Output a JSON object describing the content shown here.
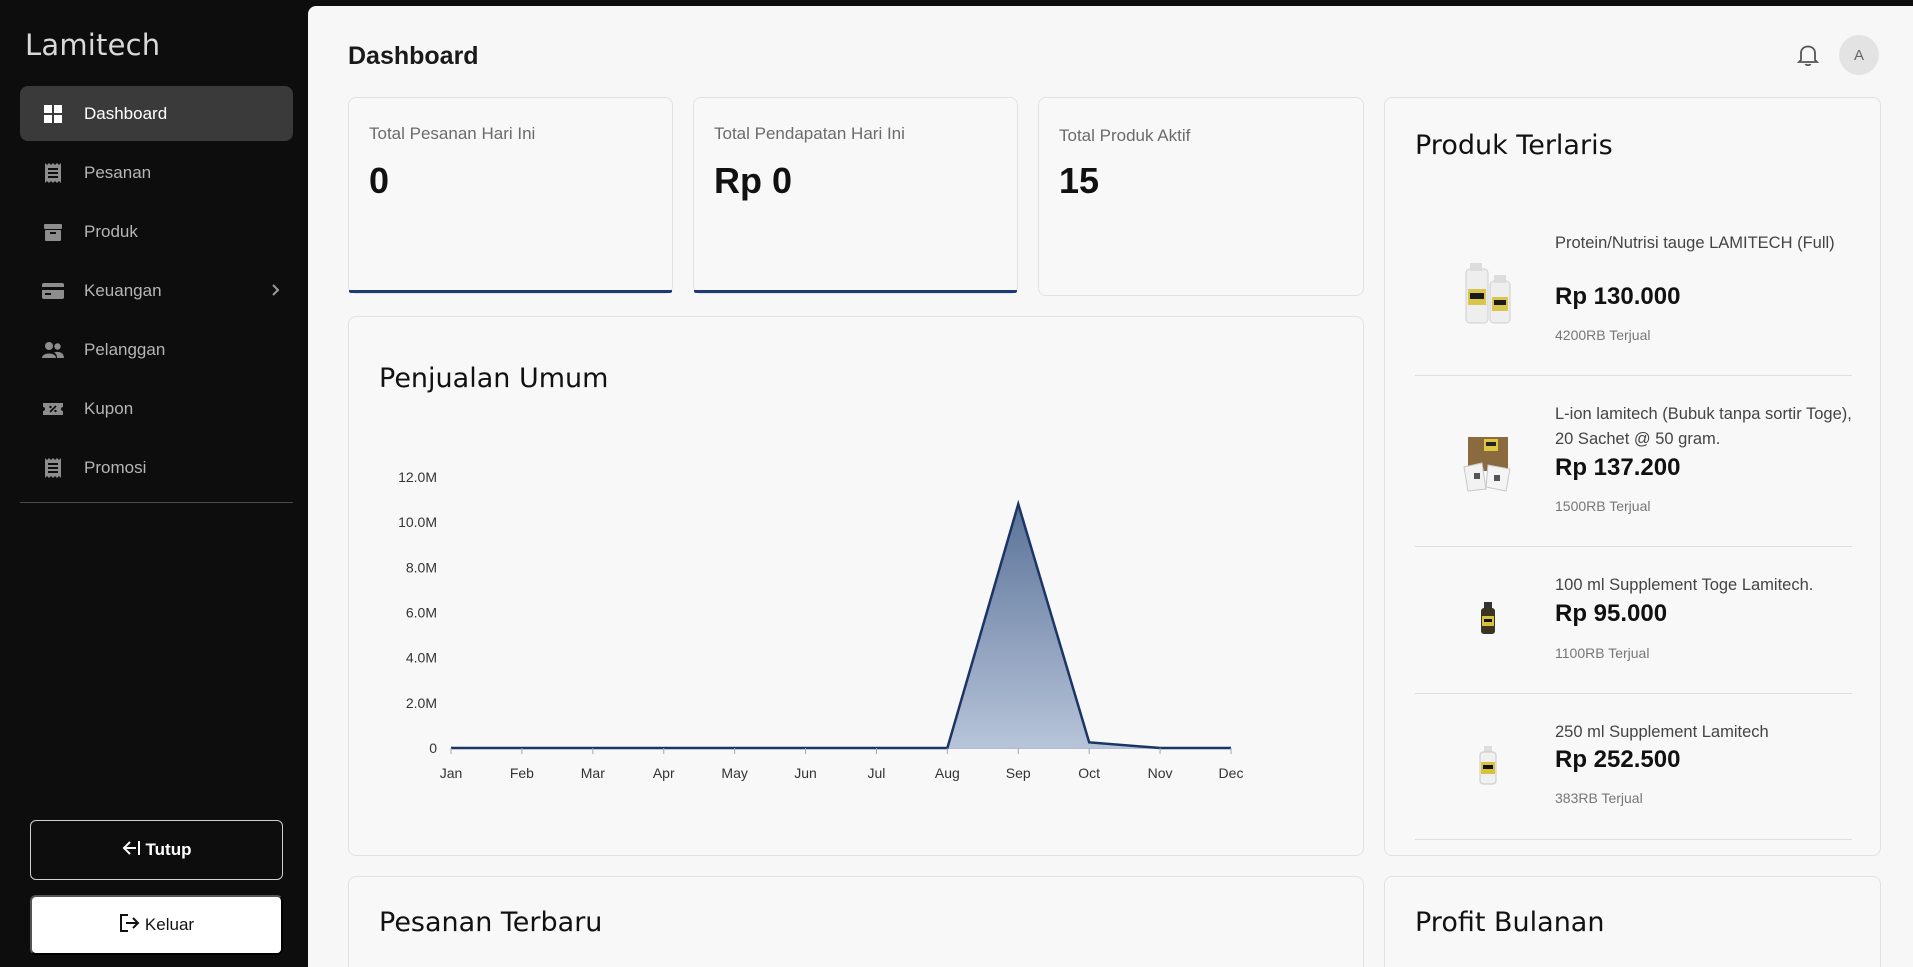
{
  "sidebar": {
    "brand": "Lamitech",
    "items": [
      {
        "label": "Dashboard",
        "icon": "dashboard-grid-icon",
        "active": true
      },
      {
        "label": "Pesanan",
        "icon": "receipt-icon"
      },
      {
        "label": "Produk",
        "icon": "archive-box-icon"
      },
      {
        "label": "Keuangan",
        "icon": "credit-card-icon",
        "has_submenu": true
      },
      {
        "label": "Pelanggan",
        "icon": "users-icon"
      },
      {
        "label": "Kupon",
        "icon": "ticket-icon"
      },
      {
        "label": "Promosi",
        "icon": "receipt-icon"
      }
    ],
    "collapse_label": "Tutup",
    "logout_label": "Keluar"
  },
  "header": {
    "title": "Dashboard",
    "avatar_initial": "A"
  },
  "stats": [
    {
      "label": "Total Pesanan Hari Ini",
      "value": "0"
    },
    {
      "label": "Total Pendapatan Hari Ini",
      "value": "Rp 0"
    },
    {
      "label": "Total Produk Aktif",
      "value": "15"
    }
  ],
  "sales_section": {
    "title": "Penjualan Umum"
  },
  "chart_data": {
    "type": "area",
    "title": "Penjualan Umum",
    "categories": [
      "Jan",
      "Feb",
      "Mar",
      "Apr",
      "May",
      "Jun",
      "Jul",
      "Aug",
      "Sep",
      "Oct",
      "Nov",
      "Dec"
    ],
    "values": [
      0,
      0,
      0,
      0,
      0,
      0,
      0,
      0,
      10800000,
      250000,
      0,
      0
    ],
    "ylim": [
      0,
      12000000
    ],
    "yticks": [
      "0",
      "2.0M",
      "4.0M",
      "6.0M",
      "8.0M",
      "10.0M",
      "12.0M"
    ],
    "colors": {
      "line": "#1a3566",
      "fill_top": "#5b7399",
      "fill_bottom": "#b7c4d9"
    }
  },
  "best_sellers": {
    "title": "Produk Terlaris",
    "items": [
      {
        "name": "Protein/Nutrisi tauge LAMITECH (Full)",
        "price": "Rp 130.000",
        "sold": "4200RB Terjual"
      },
      {
        "name": "L-ion lamitech (Bubuk tanpa sortir Toge), 20 Sachet @ 50 gram.",
        "price": "Rp 137.200",
        "sold": "1500RB Terjual"
      },
      {
        "name": "100 ml Supplement Toge Lamitech.",
        "price": "Rp 95.000",
        "sold": "1100RB Terjual"
      },
      {
        "name": "250 ml Supplement Lamitech",
        "price": "Rp 252.500",
        "sold": "383RB Terjual"
      }
    ]
  },
  "recent_orders": {
    "title": "Pesanan Terbaru"
  },
  "monthly_profit": {
    "title": "Profit Bulanan"
  }
}
